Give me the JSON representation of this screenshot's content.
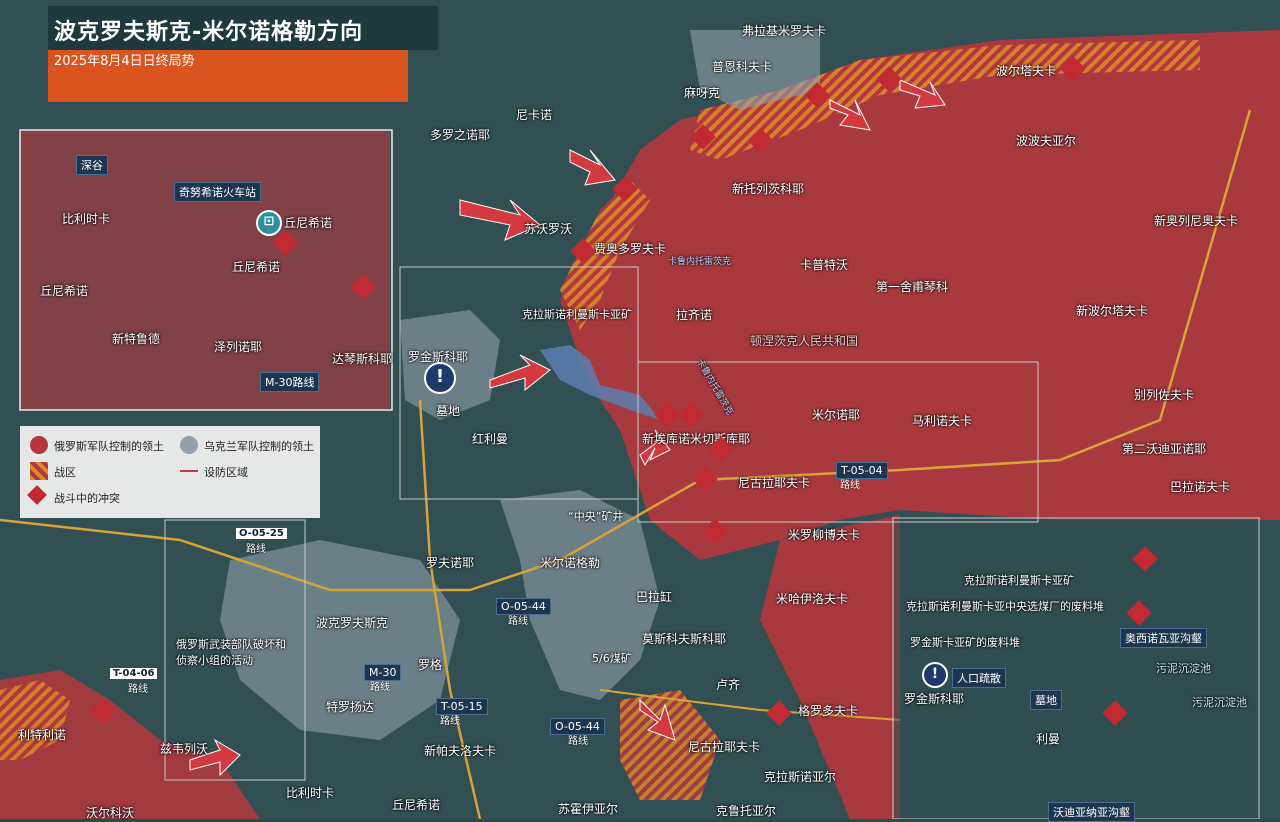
{
  "header": {
    "title": "波克罗夫斯克-米尔诺格勒方向",
    "date": "2025年8月4日日终局势"
  },
  "legend": {
    "russian_control": "俄罗斯军队控制的领土",
    "ukraine_control": "乌克兰军队控制的领土",
    "combat_zone": "战区",
    "defense_line": "设防区域",
    "clashes": "战斗中的冲突"
  },
  "colors": {
    "russian": "#b5373d",
    "ukraine": "#8fa0ac",
    "combat_zone": "#d98a2a",
    "header": "#d9541e",
    "road": "#d9a437"
  },
  "places": {
    "p1": "弗拉基米罗夫卡",
    "p2": "普恩科夫卡",
    "p3": "波尔塔夫卡",
    "p4": "麻呀克",
    "p5": "尼卡诺",
    "p6": "多罗之诺耶",
    "p7": "波波夫亚尔",
    "p8": "新托列茨科耶",
    "p9": "新奥列尼奥夫卡",
    "p10": "苏沃罗沃",
    "p11": "费奥多罗夫卡",
    "p12": "卡普特沃",
    "p13": "第一舍甫琴科",
    "p14": "新波尔塔夫卡",
    "p15": "克拉斯诺利曼斯卡亚矿",
    "p16": "拉齐诺",
    "p17": "顿涅茨克人民共和国",
    "p18": "罗金斯科耶",
    "p19": "墓地",
    "p20": "红利曼",
    "p21": "米尔诺耶",
    "p22": "马利诺夫卡",
    "p23": "别列佐夫卡",
    "p24": "新埃库诺米切斯库耶",
    "p25": "第二沃迪亚诺耶",
    "p26": "尼古拉耶夫卡",
    "p27": "巴拉诺夫卡",
    "p28": "“中央”矿井",
    "p29": "米罗柳博夫卡",
    "p30": "罗夫诺耶",
    "p31": "米尔诺格勒",
    "p32": "巴拉缸",
    "p33": "米哈伊洛夫卡",
    "p34": "波克罗夫斯克",
    "p35": "莫斯科夫斯科耶",
    "p36": "俄罗斯武装部队破坏和侦察小组的活动",
    "p37": "5/6煤矿",
    "p38": "罗格",
    "p39": "卢齐",
    "p40": "特罗扬达",
    "p41": "格罗多夫卡",
    "p42": "利特利诺",
    "p43": "兹韦列沃",
    "p44": "新帕夫洛夫卡",
    "p45": "尼古拉耶夫卡",
    "p46": "克拉斯诺亚尔",
    "p47": "沃尔科沃",
    "p48": "比利时卡",
    "p49": "丘尼希诺",
    "p50": "苏霍伊亚尔",
    "p51": "克鲁托亚尔"
  },
  "roads": {
    "r1": "O-05-25",
    "r1s": "路线",
    "r2": "O-05-44",
    "r2s": "路线",
    "r3": "M-30",
    "r3s": "路线",
    "r4": "T-04-06",
    "r4s": "路线",
    "r5": "T-05-15",
    "r5s": "路线",
    "r6": "O-05-44",
    "r6s": "路线",
    "r7": "T-05-04",
    "r7s": "路线",
    "r8": "卡鲁内托雷茨克",
    "r9": "卡鲁内托雷茨克"
  },
  "inset_left": {
    "deep_valley": "深谷",
    "station": "奇努希诺火车站",
    "belgium": "比利时卡",
    "chunishino_n": "丘尼希诺",
    "chunishino": "丘尼希诺",
    "chunishino_w": "丘尼希诺",
    "new_trudovo": "新特鲁德",
    "zelenoe": "泽列诺耶",
    "daqin": "达琴斯科耶",
    "m30": "M-30路线"
  },
  "inset_right": {
    "mine1": "克拉斯诺利曼斯卡亚矿",
    "mine2": "克拉斯诺利曼斯卡亚中央选煤厂的废料堆",
    "mine3": "罗金斯卡亚矿的废料堆",
    "ravine": "奥西诺瓦亚沟壑",
    "evac": "人口疏散",
    "rodinskoye": "罗金斯科耶",
    "sludge1": "污泥沉淀池",
    "sludge2": "污泥沉淀池",
    "cemetery": "墓地",
    "liman": "利曼",
    "ravine2": "沃迪亚纳亚沟壑"
  }
}
